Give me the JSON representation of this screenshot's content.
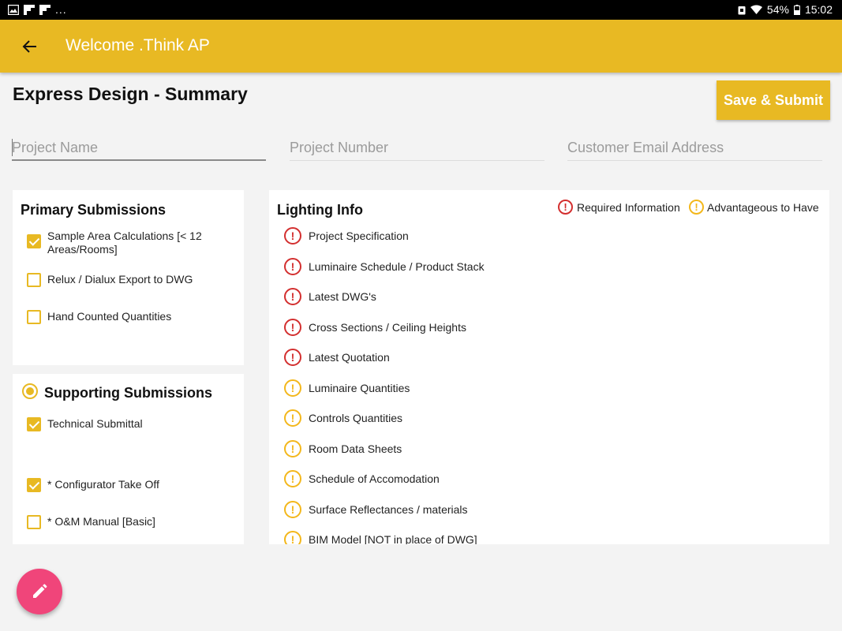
{
  "status_bar": {
    "more": "...",
    "battery": "54%",
    "time": "15:02"
  },
  "app_bar": {
    "title": "Welcome .Think AP"
  },
  "page": {
    "title": "Express Design - Summary",
    "submit_label": "Save & Submit"
  },
  "fields": {
    "project_name_placeholder": "Project Name",
    "project_number_placeholder": "Project Number",
    "customer_email_placeholder": "Customer Email Address"
  },
  "primary": {
    "title": "Primary Submissions",
    "items": [
      {
        "label": "Sample Area Calculations  [< 12 Areas/Rooms]",
        "checked": true
      },
      {
        "label": "Relux / Dialux Export to DWG",
        "checked": false
      },
      {
        "label": "Hand Counted Quantities",
        "checked": false
      }
    ]
  },
  "supporting": {
    "title": "Supporting Submissions",
    "items": [
      {
        "label": "Technical Submittal",
        "checked": true
      },
      {
        "label": "* Configurator Take Off",
        "checked": true
      },
      {
        "label": "* O&M Manual [Basic]",
        "checked": false
      }
    ]
  },
  "lighting": {
    "title": "Lighting Info",
    "legend_required": "Required Information",
    "legend_advantageous": "Advantageous to Have",
    "items": [
      {
        "label": "Project Specification",
        "type": "required"
      },
      {
        "label": "Luminaire Schedule / Product Stack",
        "type": "required"
      },
      {
        "label": "Latest DWG's",
        "type": "required"
      },
      {
        "label": "Cross Sections / Ceiling Heights",
        "type": "required"
      },
      {
        "label": "Latest Quotation",
        "type": "required"
      },
      {
        "label": "Luminaire Quantities",
        "type": "advantageous"
      },
      {
        "label": "Controls Quantities",
        "type": "advantageous"
      },
      {
        "label": "Room Data Sheets",
        "type": "advantageous"
      },
      {
        "label": "Schedule of Accomodation",
        "type": "advantageous"
      },
      {
        "label": "Surface Reflectances / materials",
        "type": "advantageous"
      },
      {
        "label": "BIM Model [NOT in place of DWG]",
        "type": "advantageous"
      }
    ]
  },
  "colors": {
    "accent": "#e8b923",
    "required": "#d32f2f",
    "advantageous": "#f3b71b",
    "fab": "#f0457a"
  },
  "icons": {
    "back": "arrow-back-icon",
    "fab": "pencil-icon"
  }
}
